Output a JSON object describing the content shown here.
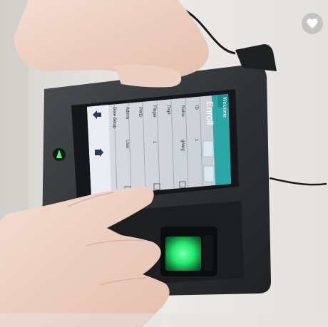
{
  "screen": {
    "status_title": "Welcome",
    "header_title": "Enroll",
    "rows": [
      {
        "label": "ID",
        "value": "1"
      },
      {
        "label": "Name",
        "value": "gwing"
      },
      {
        "label": "Dept",
        "value": ""
      },
      {
        "label": "Finger",
        "value": "1"
      },
      {
        "label": "PWD",
        "value": ""
      },
      {
        "label": "Admin",
        "value": "User"
      },
      {
        "label": "Door Setup",
        "value": ""
      }
    ]
  },
  "colors": {
    "header_teal": "#2aa7a6",
    "fingerprint_glow": "#33ff7a",
    "device_body": "#2e3133",
    "wall": "#e8e6e2"
  },
  "icons": [
    "heart-icon",
    "up-arrow-icon",
    "home-arrow-icon",
    "fingerprint-sensor",
    "status-led-icon"
  ]
}
